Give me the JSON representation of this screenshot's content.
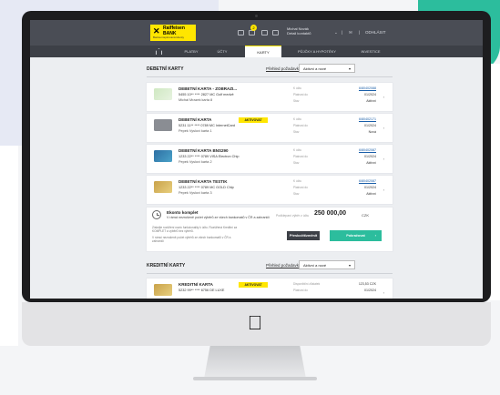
{
  "bank": {
    "name_line1": "Raiffeisen",
    "name_line2": "BANK",
    "tagline": "Banka inspirovaná klienty"
  },
  "topbar": {
    "notification_count": "2",
    "user_name": "Michal Novák",
    "user_sub": "Detail kontaktů",
    "logout_label": "ODHLÁSIT"
  },
  "nav": {
    "items": [
      {
        "label": "PLATBY"
      },
      {
        "label": "ÚČTY"
      },
      {
        "label": "KARTY"
      },
      {
        "label": "PŮJČKY A HYPOTÉKY"
      },
      {
        "label": "INVESTICE"
      }
    ]
  },
  "debit_section": {
    "title": "DEBETNÍ KARTY",
    "overview_link": "Přehled požadavků",
    "filter_value": "Aktivní a nové"
  },
  "debit_cards": [
    {
      "name": "DEBETNÍ KARTA - ZOBRAZI...",
      "number": "5455 10** **** 2827 MC Golf medvě",
      "owner": "Michal Mrazek karta 8",
      "badge": "",
      "label1": "K účtu",
      "value1": "6/80402088",
      "label2": "Platnost do",
      "value2": "01/2024",
      "label3": "Stav",
      "value3": "Aktivní"
    },
    {
      "name": "DEBETNÍ KARTA",
      "number": "5231 11** **** 0789 MC InternetCard",
      "owner": "Pepek Vysloví karta 1",
      "badge": "AKTIVOVAT",
      "label1": "K účtu",
      "value1": "6/80402171",
      "label2": "Platnost do",
      "value2": "01/2024",
      "label3": "Stav",
      "value3": "Nová"
    },
    {
      "name": "DEBETNÍ KARTA BNS290",
      "number": "1233 22** **** 0789 VISA Electron Chip",
      "owner": "Pepek Vysloví karta 2",
      "badge": "",
      "label1": "K účtu",
      "value1": "6/80402087",
      "label2": "Platnost do",
      "value2": "01/2024",
      "label3": "Stav",
      "value3": "Aktivní"
    },
    {
      "name": "DEBETNÍ KARTA TESTIK",
      "number": "1233 22** **** 0789 MC GOLD Chip",
      "owner": "Pepek Vysloví karta 3",
      "badge": "",
      "label1": "K účtu",
      "value1": "6/80402087",
      "label2": "Platnost do",
      "value2": "01/2024",
      "label3": "Stav",
      "value3": "Aktivní"
    }
  ],
  "komplet": {
    "title": "Ekonto komplet",
    "desc": "V rámci nezrušeně počet výběrů ze všech bankomatů v ČR a zahraničí",
    "label": "Podklepaní výběr z účtu",
    "amount": "250 000,00",
    "currency": "CZK",
    "help1": "Získejte rozšíření navíc funkcionality k účtu. Rozšířená Kreditní za KOMPLET a výběrů bez výběrů.",
    "help2": "V rámci nezrušeně počet výběrů ze všech bankomatů v ČR a zahraničí",
    "secondary_button": "Přeskočit/změnit",
    "primary_button": "Pokračovat"
  },
  "credit_section": {
    "title": "KREDITNÍ KARTY",
    "overview_link": "Přehled požadavků",
    "filter_value": "Aktivní a nové"
  },
  "credit_cards": [
    {
      "name": "KREDITNÍ KARTA",
      "number": "5232 99** **** 6756 DE LUXE",
      "badge": "AKTIVOVAT",
      "label1": "Disponibilní zůstatek",
      "value1": "123,53 CZK",
      "label2": "Platnost do",
      "value2": "01/2024"
    }
  ]
}
